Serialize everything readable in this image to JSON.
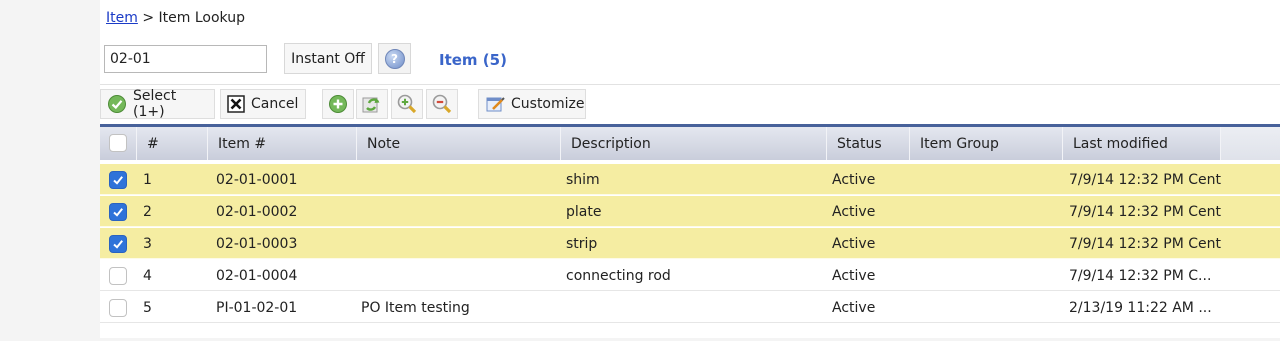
{
  "breadcrumb": {
    "root": "Item",
    "separator": ">",
    "current": "Item Lookup"
  },
  "search": {
    "value": "02-01",
    "instant_label": "Instant Off",
    "help_glyph": "?"
  },
  "result_title": "Item (5)",
  "toolbar": {
    "select_label": "Select (1+)",
    "cancel_label": "Cancel",
    "customize_label": "Customize",
    "icons": [
      "check-circle-icon",
      "close-box-icon",
      "add-circle-icon",
      "refresh-icon",
      "zoom-in-icon",
      "zoom-out-icon",
      "customize-icon"
    ]
  },
  "grid": {
    "columns": [
      "#",
      "Item #",
      "Note",
      "Description",
      "Status",
      "Item Group",
      "Last modified"
    ],
    "rows": [
      {
        "checked": true,
        "num": "1",
        "item_no": "02-01-0001",
        "note": "",
        "description": "shim",
        "status": "Active",
        "group": "",
        "modified": "7/9/14 12:32 PM Cent"
      },
      {
        "checked": true,
        "num": "2",
        "item_no": "02-01-0002",
        "note": "",
        "description": "plate",
        "status": "Active",
        "group": "",
        "modified": "7/9/14 12:32 PM Cent"
      },
      {
        "checked": true,
        "num": "3",
        "item_no": "02-01-0003",
        "note": "",
        "description": "strip",
        "status": "Active",
        "group": "",
        "modified": "7/9/14 12:32 PM Cent"
      },
      {
        "checked": false,
        "num": "4",
        "item_no": "02-01-0004",
        "note": "",
        "description": "connecting rod",
        "status": "Active",
        "group": "",
        "modified": "7/9/14 12:32 PM C..."
      },
      {
        "checked": false,
        "num": "5",
        "item_no": "PI-01-02-01",
        "note": "PO Item testing",
        "description": "",
        "status": "Active",
        "group": "",
        "modified": "2/13/19 11:22 AM ..."
      }
    ]
  },
  "colors": {
    "selected_row": "#f5eda2",
    "accent": "#3a65c9",
    "header_border": "#47619a",
    "checkbox": "#2f73d9"
  }
}
